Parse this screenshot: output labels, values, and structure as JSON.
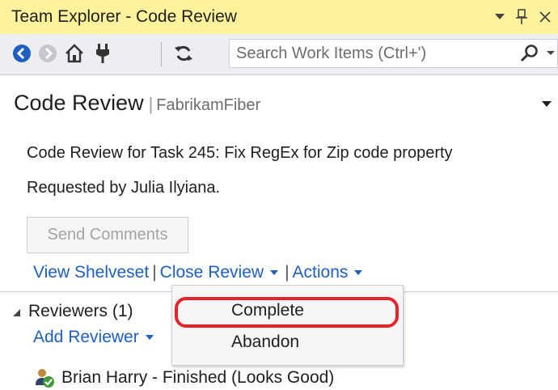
{
  "titlebar": {
    "title": "Team Explorer - Code Review"
  },
  "toolbar": {
    "search_placeholder": "Search Work Items (Ctrl+')"
  },
  "page": {
    "title": "Code Review",
    "project": "FabrikamFiber"
  },
  "review": {
    "description": "Code Review for Task 245: Fix RegEx for Zip code property",
    "requested_by": "Requested by Julia Ilyiana."
  },
  "actions": {
    "send_comments": "Send Comments",
    "view_shelveset": "View Shelveset",
    "close_review": "Close Review",
    "actions": "Actions"
  },
  "close_review_menu": {
    "items": [
      "Complete",
      "Abandon"
    ],
    "highlighted": "Complete"
  },
  "reviewers": {
    "header": "Reviewers (1)",
    "add_reviewer": "Add Reviewer",
    "list": [
      {
        "name": "Brian Harry - Finished (Looks Good)"
      }
    ]
  },
  "colors": {
    "titlebar_bg": "#fff29d",
    "link": "#1e5fbf",
    "highlight": "#e6242e",
    "toolbar_bg": "#eeeef2"
  },
  "icons": [
    "dropdown-arrow-icon",
    "pin-icon",
    "close-icon",
    "back-icon",
    "forward-icon",
    "home-icon",
    "connect-icon",
    "refresh-icon",
    "search-icon",
    "reviewer-approved-icon"
  ]
}
